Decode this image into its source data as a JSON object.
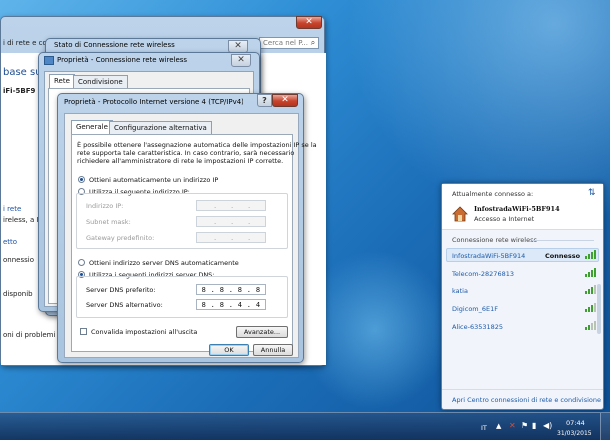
{
  "explorer": {
    "breadcrumb": "i di rete e condivisione",
    "search_placeholder": "Cerca nel P...",
    "heading_fragment": "base sull",
    "network_fragment": "iFi-5BF9",
    "link1": "i rete",
    "text1": "ireless, a In",
    "text2": "etto",
    "text3": "onnessio",
    "text4": "disponib",
    "text5": "oni di problemi di rete o informazioni per la risoluzione dei problemi."
  },
  "status_window": {
    "title": "Stato di Connessione rete wireless"
  },
  "wireless_props": {
    "title": "Proprietà - Connessione rete wireless",
    "tabs": [
      "Rete",
      "Condivisione"
    ]
  },
  "ipv4_dialog": {
    "title": "Proprietà - Protocollo Internet versione 4 (TCP/IPv4)",
    "tabs": [
      "Generale",
      "Configurazione alternativa"
    ],
    "description": "È possibile ottenere l'assegnazione automatica delle impostazioni IP se la rete supporta tale caratteristica. In caso contrario, sarà necessario richiedere all'amministratore di rete le impostazioni IP corrette.",
    "description_lines": [
      "È possibile ottenere l'assegnazione automatica delle impostazioni IP se la",
      "rete supporta tale caratteristica. In caso contrario, sarà necessario",
      "richiedere all'amministratore di rete le impostazioni IP corrette."
    ],
    "radio_auto_ip": "Ottieni automaticamente un indirizzo IP",
    "radio_manual_ip": "Utilizza il seguente indirizzo IP:",
    "ip_address_label": "Indirizzo IP:",
    "subnet_label": "Subnet mask:",
    "gateway_label": "Gateway predefinito:",
    "radio_auto_dns": "Ottieni indirizzo server DNS automaticamente",
    "radio_manual_dns": "Utilizza i seguenti indirizzi server DNS:",
    "preferred_dns_label": "Server DNS preferito:",
    "preferred_dns_value": "8 . 8 . 8 . 8",
    "alternate_dns_label": "Server DNS alternativo:",
    "alternate_dns_value": "8 . 8 . 4 . 4",
    "validate_checkbox": "Convalida impostazioni all'uscita",
    "advanced_button": "Avanzate...",
    "ok_button": "OK",
    "cancel_button": "Annulla"
  },
  "network_flyout": {
    "connected_label": "Attualmente connesso a:",
    "current_network": "InfostradaWiFi-5BF914",
    "current_status": "Accesso a Internet",
    "section_title": "Connessione rete wireless",
    "networks": [
      {
        "name": "InfostradaWiFi-5BF914",
        "status": "Connesso"
      },
      {
        "name": "Telecom-28276813",
        "status": ""
      },
      {
        "name": "katia",
        "status": ""
      },
      {
        "name": "Digicom_6E1F",
        "status": ""
      },
      {
        "name": "Alice-63531825",
        "status": ""
      }
    ],
    "footer_link": "Apri Centro connessioni di rete e condivisione"
  },
  "taskbar": {
    "language": "IT",
    "time": "07:44",
    "date": "31/03/2015"
  },
  "colors": {
    "link_blue": "#1e5aa8",
    "signal_green": "#3da12e",
    "close_red": "#c8432c"
  }
}
